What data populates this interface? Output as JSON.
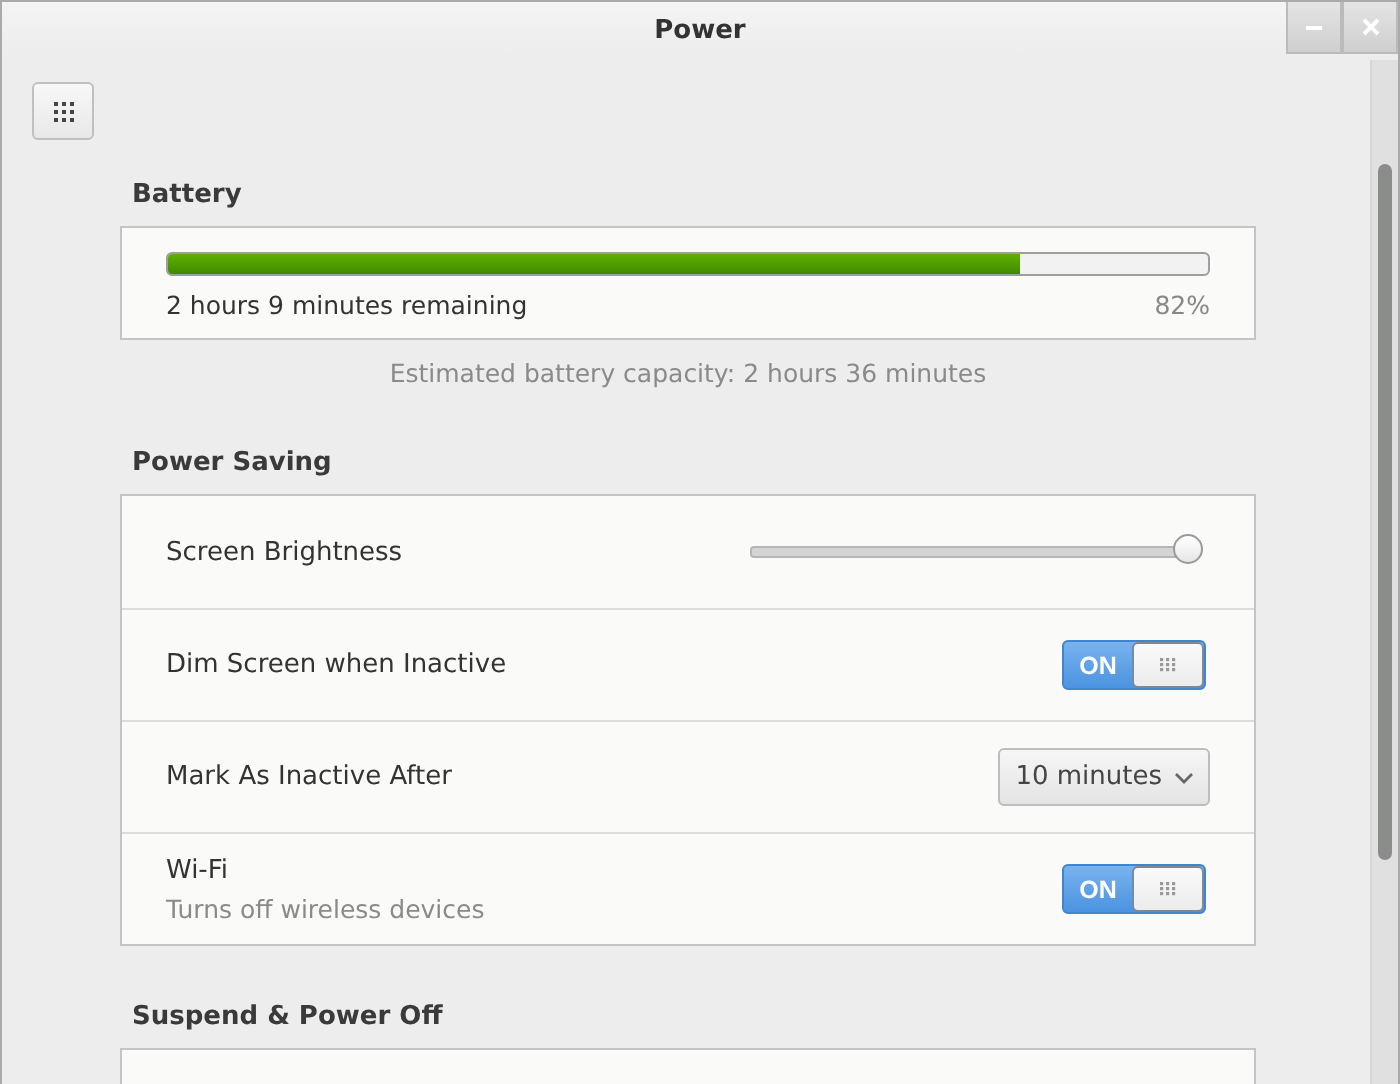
{
  "window": {
    "title": "Power"
  },
  "battery": {
    "heading": "Battery",
    "level": 0.82,
    "remaining": "2 hours 9 minutes remaining",
    "percent": "82%",
    "capacity": "Estimated battery capacity: 2 hours 36 minutes"
  },
  "power_saving": {
    "heading": "Power Saving",
    "rows": [
      {
        "kind": "slider",
        "label": "Screen Brightness",
        "level": 1.0
      },
      {
        "kind": "switch",
        "label": "Dim Screen when Inactive",
        "on": true,
        "state_label": "ON"
      },
      {
        "kind": "dropdown",
        "label": "Mark As Inactive After",
        "value": "10 minutes"
      },
      {
        "kind": "switch",
        "label": "Wi-Fi",
        "subtitle": "Turns off wireless devices",
        "on": true,
        "state_label": "ON"
      }
    ]
  },
  "suspend": {
    "heading": "Suspend & Power Off"
  }
}
